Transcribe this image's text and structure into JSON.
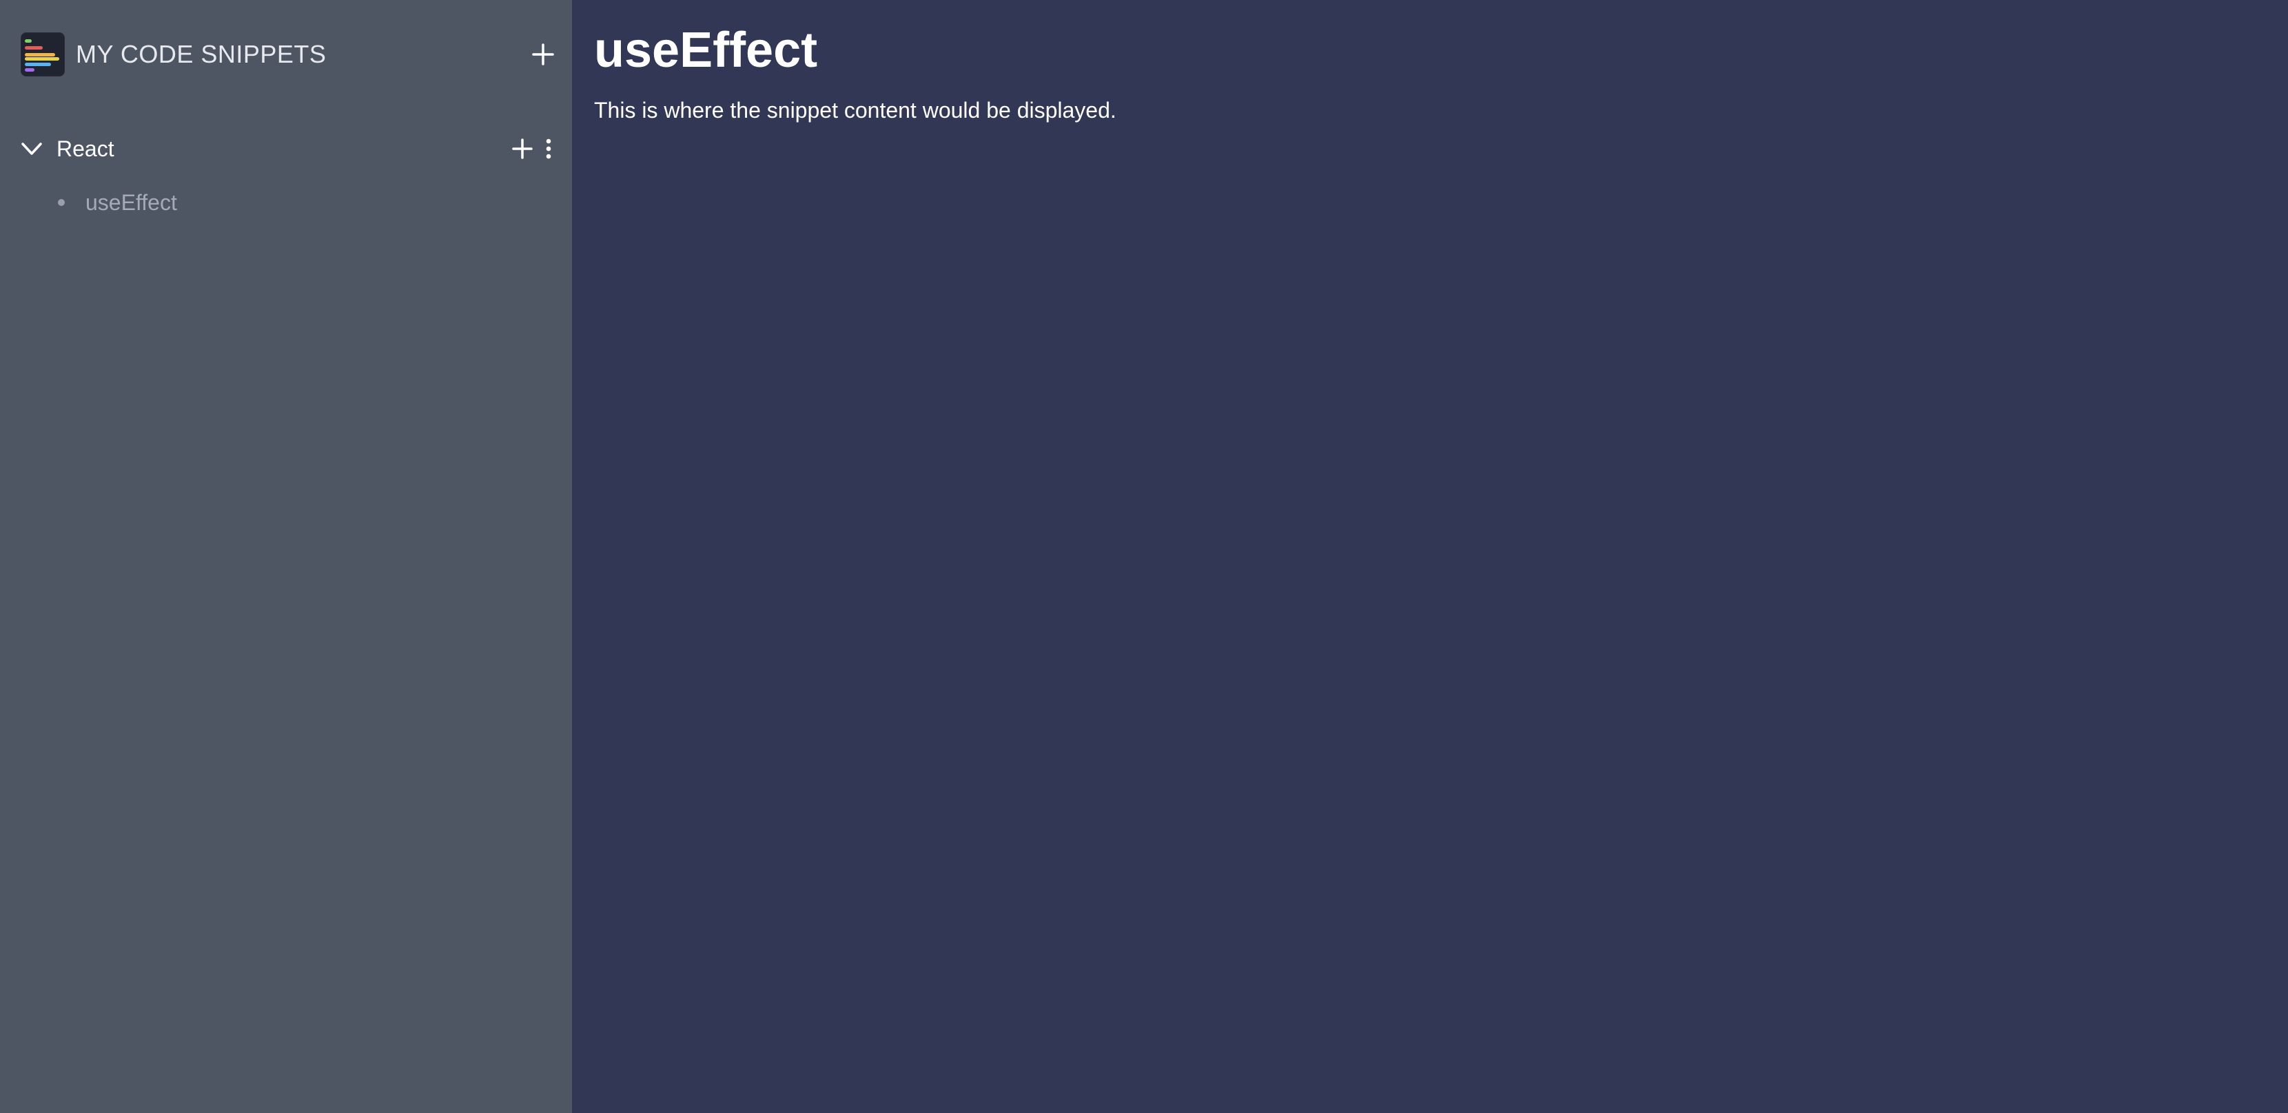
{
  "sidebar": {
    "app_title": "MY CODE SNIPPETS",
    "logo_icon": "code-file-icon",
    "add_icon": "plus-icon",
    "folders": [
      {
        "name": "React",
        "expanded": true,
        "toggle_icon": "chevron-down-icon",
        "add_icon": "plus-icon",
        "menu_icon": "vertical-dots-icon",
        "snippets": [
          {
            "label": "useEffect"
          }
        ]
      }
    ]
  },
  "main": {
    "title": "useEffect",
    "content": "This is where the snippet content would be displayed."
  },
  "colors": {
    "sidebar_bg": "#4f5663",
    "main_bg": "#323756",
    "text_primary": "#ffffff",
    "text_muted": "#a4abb6"
  }
}
